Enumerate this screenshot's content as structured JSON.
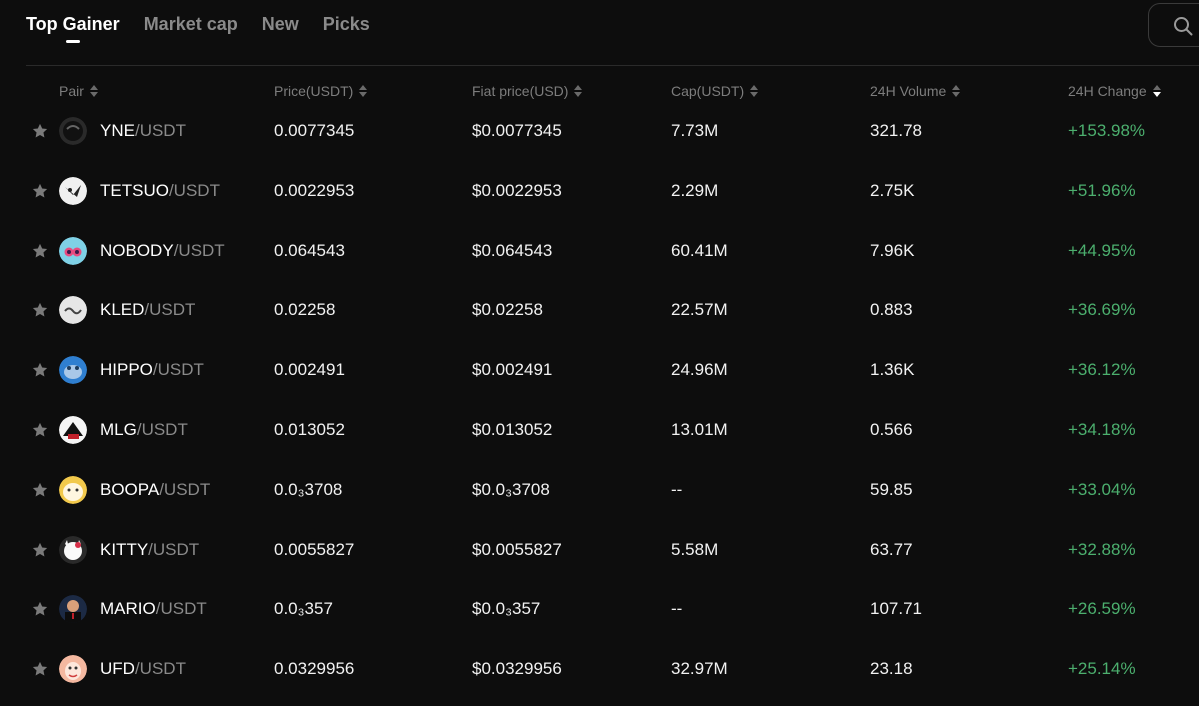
{
  "tabs": [
    {
      "label": "Top Gainer",
      "active": true
    },
    {
      "label": "Market cap",
      "active": false
    },
    {
      "label": "New",
      "active": false
    },
    {
      "label": "Picks",
      "active": false
    }
  ],
  "search": {
    "icon": "search-icon"
  },
  "columns": {
    "pair": "Pair",
    "price": "Price(USDT)",
    "fiat": "Fiat price(USD)",
    "cap": "Cap(USDT)",
    "volume": "24H Volume",
    "change": "24H Change"
  },
  "colors": {
    "positive": "#4caf6e",
    "background": "#0d0d0d"
  },
  "rows": [
    {
      "base": "YNE",
      "quote": "/USDT",
      "price": "0.0077345",
      "fiat": "$0.0077345",
      "cap": "7.73M",
      "volume": "321.78",
      "change": "+153.98%",
      "icon": "yne-coin-icon"
    },
    {
      "base": "TETSUO",
      "quote": "/USDT",
      "price": "0.0022953",
      "fiat": "$0.0022953",
      "cap": "2.29M",
      "volume": "2.75K",
      "change": "+51.96%",
      "icon": "tetsuo-coin-icon"
    },
    {
      "base": "NOBODY",
      "quote": "/USDT",
      "price": "0.064543",
      "fiat": "$0.064543",
      "cap": "60.41M",
      "volume": "7.96K",
      "change": "+44.95%",
      "icon": "nobody-coin-icon"
    },
    {
      "base": "KLED",
      "quote": "/USDT",
      "price": "0.02258",
      "fiat": "$0.02258",
      "cap": "22.57M",
      "volume": "0.883",
      "change": "+36.69%",
      "icon": "kled-coin-icon"
    },
    {
      "base": "HIPPO",
      "quote": "/USDT",
      "price": "0.002491",
      "fiat": "$0.002491",
      "cap": "24.96M",
      "volume": "1.36K",
      "change": "+36.12%",
      "icon": "hippo-coin-icon"
    },
    {
      "base": "MLG",
      "quote": "/USDT",
      "price": "0.013052",
      "fiat": "$0.013052",
      "cap": "13.01M",
      "volume": "0.566",
      "change": "+34.18%",
      "icon": "mlg-coin-icon"
    },
    {
      "base": "BOOPA",
      "quote": "/USDT",
      "price": "0.0₃3708",
      "fiat": "$0.0₃3708",
      "cap": "--",
      "volume": "59.85",
      "change": "+33.04%",
      "icon": "boopa-coin-icon"
    },
    {
      "base": "KITTY",
      "quote": "/USDT",
      "price": "0.0055827",
      "fiat": "$0.0055827",
      "cap": "5.58M",
      "volume": "63.77",
      "change": "+32.88%",
      "icon": "kitty-coin-icon"
    },
    {
      "base": "MARIO",
      "quote": "/USDT",
      "price": "0.0₃357",
      "fiat": "$0.0₃357",
      "cap": "--",
      "volume": "107.71",
      "change": "+26.59%",
      "icon": "mario-coin-icon"
    },
    {
      "base": "UFD",
      "quote": "/USDT",
      "price": "0.0329956",
      "fiat": "$0.0329956",
      "cap": "32.97M",
      "volume": "23.18",
      "change": "+25.14%",
      "icon": "ufd-coin-icon"
    }
  ]
}
